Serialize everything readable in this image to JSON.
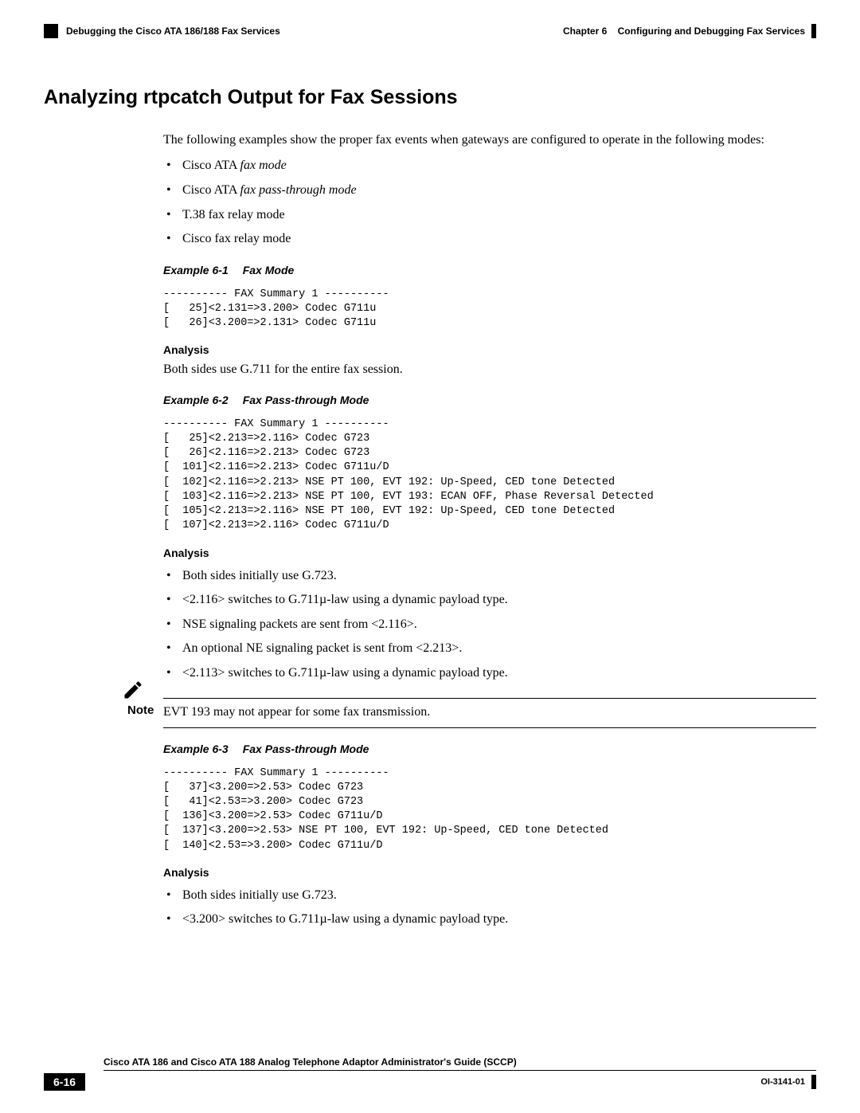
{
  "header": {
    "left": "Debugging the Cisco ATA 186/188 Fax Services",
    "chapter": "Chapter 6",
    "right": "Configuring and Debugging Fax Services"
  },
  "title": "Analyzing rtpcatch Output for Fax Sessions",
  "intro": "The following examples show the proper fax events when gateways are configured to operate in the following modes:",
  "modes": {
    "m1a": "Cisco ATA ",
    "m1b": "fax mode",
    "m2a": "Cisco ATA ",
    "m2b": "fax pass-through mode",
    "m3": "T.38 fax relay mode",
    "m4": "Cisco fax relay mode"
  },
  "ex1": {
    "num": "Example 6-1",
    "name": "Fax Mode",
    "code": "---------- FAX Summary 1 ----------\n[   25]<2.131=>3.200> Codec G711u\n[   26]<3.200=>2.131> Codec G711u",
    "analysis_label": "Analysis",
    "analysis": "Both sides use G.711 for the entire fax session."
  },
  "ex2": {
    "num": "Example 6-2",
    "name": "Fax Pass-through Mode",
    "code": "---------- FAX Summary 1 ----------\n[   25]<2.213=>2.116> Codec G723\n[   26]<2.116=>2.213> Codec G723\n[  101]<2.116=>2.213> Codec G711u/D\n[  102]<2.116=>2.213> NSE PT 100, EVT 192: Up-Speed, CED tone Detected\n[  103]<2.116=>2.213> NSE PT 100, EVT 193: ECAN OFF, Phase Reversal Detected\n[  105]<2.213=>2.116> NSE PT 100, EVT 192: Up-Speed, CED tone Detected\n[  107]<2.213=>2.116> Codec G711u/D",
    "analysis_label": "Analysis",
    "bullets": {
      "b1": "Both sides initially use G.723.",
      "b2": "<2.116> switches to G.711µ-law using a dynamic payload type.",
      "b3": "NSE signaling packets are sent from <2.116>.",
      "b4": "An optional NE signaling packet is sent from <2.213>.",
      "b5": "<2.113> switches to G.711µ-law using a dynamic payload type."
    }
  },
  "note": {
    "label": "Note",
    "text": "EVT 193 may not appear for some fax transmission."
  },
  "ex3": {
    "num": "Example 6-3",
    "name": "Fax Pass-through Mode",
    "code": "---------- FAX Summary 1 ----------\n[   37]<3.200=>2.53> Codec G723\n[   41]<2.53=>3.200> Codec G723\n[  136]<3.200=>2.53> Codec G711u/D\n[  137]<3.200=>2.53> NSE PT 100, EVT 192: Up-Speed, CED tone Detected\n[  140]<2.53=>3.200> Codec G711u/D",
    "analysis_label": "Analysis",
    "bullets": {
      "b1": "Both sides initially use G.723.",
      "b2": "<3.200> switches to G.711µ-law using a dynamic payload type."
    }
  },
  "footer": {
    "title": "Cisco ATA 186 and Cisco ATA 188 Analog Telephone Adaptor Administrator's Guide (SCCP)",
    "page": "6-16",
    "docid": "OI-3141-01"
  }
}
